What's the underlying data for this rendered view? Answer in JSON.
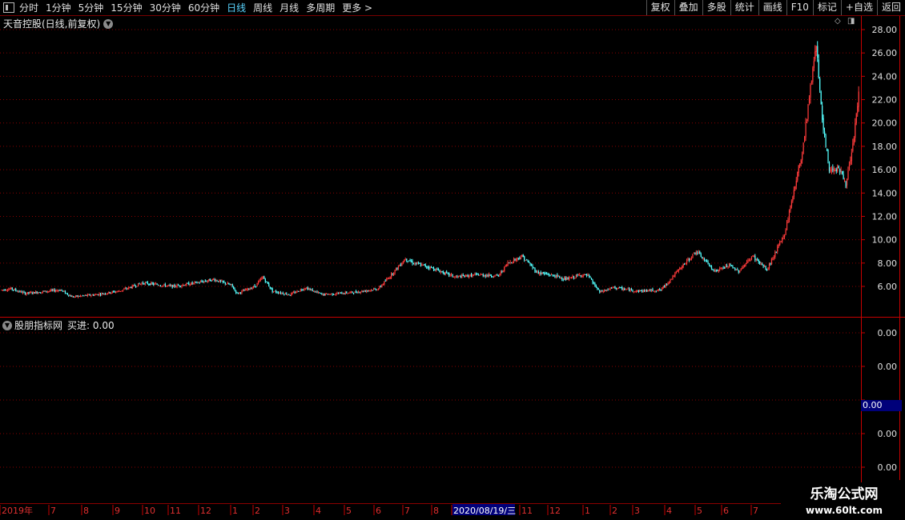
{
  "toolbar": {
    "periods": [
      "分时",
      "1分钟",
      "5分钟",
      "15分钟",
      "30分钟",
      "60分钟",
      "日线",
      "周线",
      "月线",
      "多周期",
      "更多 >"
    ],
    "active_period": "日线",
    "right_buttons": [
      "复权",
      "叠加",
      "多股",
      "统计",
      "画线",
      "F10",
      "标记",
      "+自选",
      "返回"
    ]
  },
  "main_chart": {
    "title": "天音控股(日线,前复权)",
    "y_ticks": [
      "28.00",
      "26.00",
      "24.00",
      "22.00",
      "20.00",
      "18.00",
      "16.00",
      "14.00",
      "12.00",
      "10.00",
      "8.00",
      "6.00"
    ]
  },
  "indicator_panel": {
    "title": "股朋指标网",
    "value_label": "买进: 0.00",
    "y_ticks": [
      "0.00",
      "0.00",
      "0.00",
      "0.00",
      "0.00"
    ],
    "last_value": "0.00"
  },
  "time_axis": {
    "labels": [
      "2019年",
      "7",
      "8",
      "9",
      "10",
      "11",
      "12",
      "1",
      "2",
      "3",
      "4",
      "5",
      "6",
      "7",
      "8",
      "2020/08/19/三",
      "11",
      "12",
      "1",
      "2",
      "3",
      "4",
      "5",
      "6",
      "7"
    ],
    "highlight": "2020/08/19/三"
  },
  "watermark": {
    "title": "乐淘公式网",
    "url": "www.60lt.com"
  },
  "colors": {
    "up": "#ff3b3b",
    "down": "#54ffff",
    "grid": "#8a0000",
    "axis": "#c80000",
    "cursor_bg": "#00007a"
  },
  "chart_data": {
    "type": "candlestick",
    "title": "天音控股(日线,前复权)",
    "ylim": [
      4.0,
      29.0
    ],
    "anchors": [
      [
        0,
        5.7
      ],
      [
        8,
        5.8
      ],
      [
        20,
        5.4
      ],
      [
        40,
        5.6
      ],
      [
        50,
        5.7
      ],
      [
        60,
        5.1
      ],
      [
        80,
        5.3
      ],
      [
        100,
        5.6
      ],
      [
        120,
        6.3
      ],
      [
        145,
        6.0
      ],
      [
        165,
        6.3
      ],
      [
        180,
        6.6
      ],
      [
        195,
        6.1
      ],
      [
        200,
        5.4
      ],
      [
        215,
        6.0
      ],
      [
        222,
        6.8
      ],
      [
        230,
        5.6
      ],
      [
        245,
        5.3
      ],
      [
        258,
        5.9
      ],
      [
        272,
        5.3
      ],
      [
        300,
        5.5
      ],
      [
        320,
        5.8
      ],
      [
        330,
        6.9
      ],
      [
        343,
        8.4
      ],
      [
        350,
        8.0
      ],
      [
        365,
        7.6
      ],
      [
        385,
        6.8
      ],
      [
        405,
        7.0
      ],
      [
        422,
        6.9
      ],
      [
        430,
        8.0
      ],
      [
        442,
        8.6
      ],
      [
        455,
        7.2
      ],
      [
        470,
        6.9
      ],
      [
        480,
        6.6
      ],
      [
        492,
        7.0
      ],
      [
        498,
        6.9
      ],
      [
        508,
        5.5
      ],
      [
        520,
        5.9
      ],
      [
        540,
        5.6
      ],
      [
        560,
        5.7
      ],
      [
        576,
        7.5
      ],
      [
        590,
        9.0
      ],
      [
        606,
        7.3
      ],
      [
        618,
        7.8
      ],
      [
        626,
        7.3
      ],
      [
        638,
        8.6
      ],
      [
        650,
        7.4
      ],
      [
        665,
        10.5
      ],
      [
        680,
        17.5
      ],
      [
        692,
        27.0
      ],
      [
        697,
        20.0
      ],
      [
        703,
        16.0
      ],
      [
        711,
        16.2
      ],
      [
        717,
        14.8
      ],
      [
        722,
        17.2
      ],
      [
        728,
        22.5
      ]
    ]
  }
}
